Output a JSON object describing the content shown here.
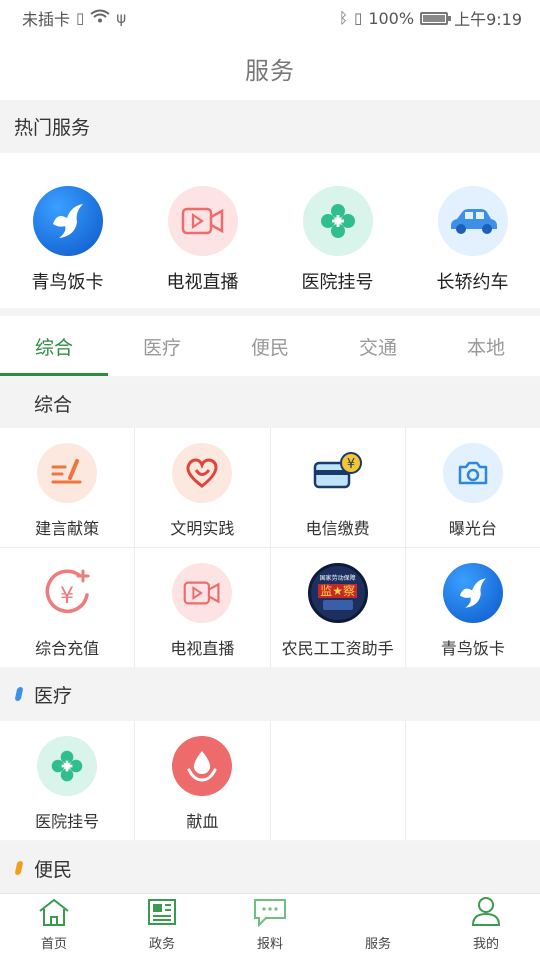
{
  "status_bar": {
    "carrier": "未插卡",
    "battery_percent": "100%",
    "battery_level": 1.0,
    "time": "上午9:19"
  },
  "header": {
    "title": "服务"
  },
  "hot_section": {
    "title": "热门服务",
    "items": [
      {
        "label": "青鸟饭卡",
        "icon": "bird-icon"
      },
      {
        "label": "电视直播",
        "icon": "video-icon"
      },
      {
        "label": "医院挂号",
        "icon": "medical-cross-icon"
      },
      {
        "label": "长轿约车",
        "icon": "car-icon"
      }
    ]
  },
  "tabs": [
    {
      "label": "综合",
      "active": true
    },
    {
      "label": "医疗",
      "active": false
    },
    {
      "label": "便民",
      "active": false
    },
    {
      "label": "交通",
      "active": false
    },
    {
      "label": "本地",
      "active": false
    }
  ],
  "categories": {
    "general": {
      "title": "综合",
      "items": [
        {
          "label": "建言献策",
          "icon": "pen-note-icon"
        },
        {
          "label": "文明实践",
          "icon": "heart-icon"
        },
        {
          "label": "电信缴费",
          "icon": "card-payment-icon"
        },
        {
          "label": "曝光台",
          "icon": "camera-icon"
        },
        {
          "label": "综合充值",
          "icon": "yuan-recharge-icon"
        },
        {
          "label": "电视直播",
          "icon": "video-icon"
        },
        {
          "label": "农民工工资助手",
          "icon": "labor-badge-icon"
        },
        {
          "label": "青鸟饭卡",
          "icon": "bird-icon"
        }
      ]
    },
    "medical": {
      "title": "医疗",
      "mark_color": "#3d8fe8",
      "items": [
        {
          "label": "医院挂号",
          "icon": "medical-cross-icon"
        },
        {
          "label": "献血",
          "icon": "blood-drop-icon"
        }
      ]
    },
    "convenience": {
      "title": "便民",
      "mark_color": "#f0a020"
    }
  },
  "labor_badge_text": {
    "top": "国家劳动保障",
    "middle": "监★察"
  },
  "bottom_nav": [
    {
      "label": "首页",
      "icon": "home-icon"
    },
    {
      "label": "政务",
      "icon": "newspaper-icon"
    },
    {
      "label": "报料",
      "icon": "chat-icon"
    },
    {
      "label": "服务",
      "icon": "service-icon"
    },
    {
      "label": "我的",
      "icon": "person-icon"
    }
  ],
  "colors": {
    "accent": "#2f8b3e",
    "hot_bird_bg": "#1a73d9",
    "video_bg": "#fde3e3",
    "medical_bg": "#d9f4ea",
    "car_bg": "#e3f0fd"
  }
}
